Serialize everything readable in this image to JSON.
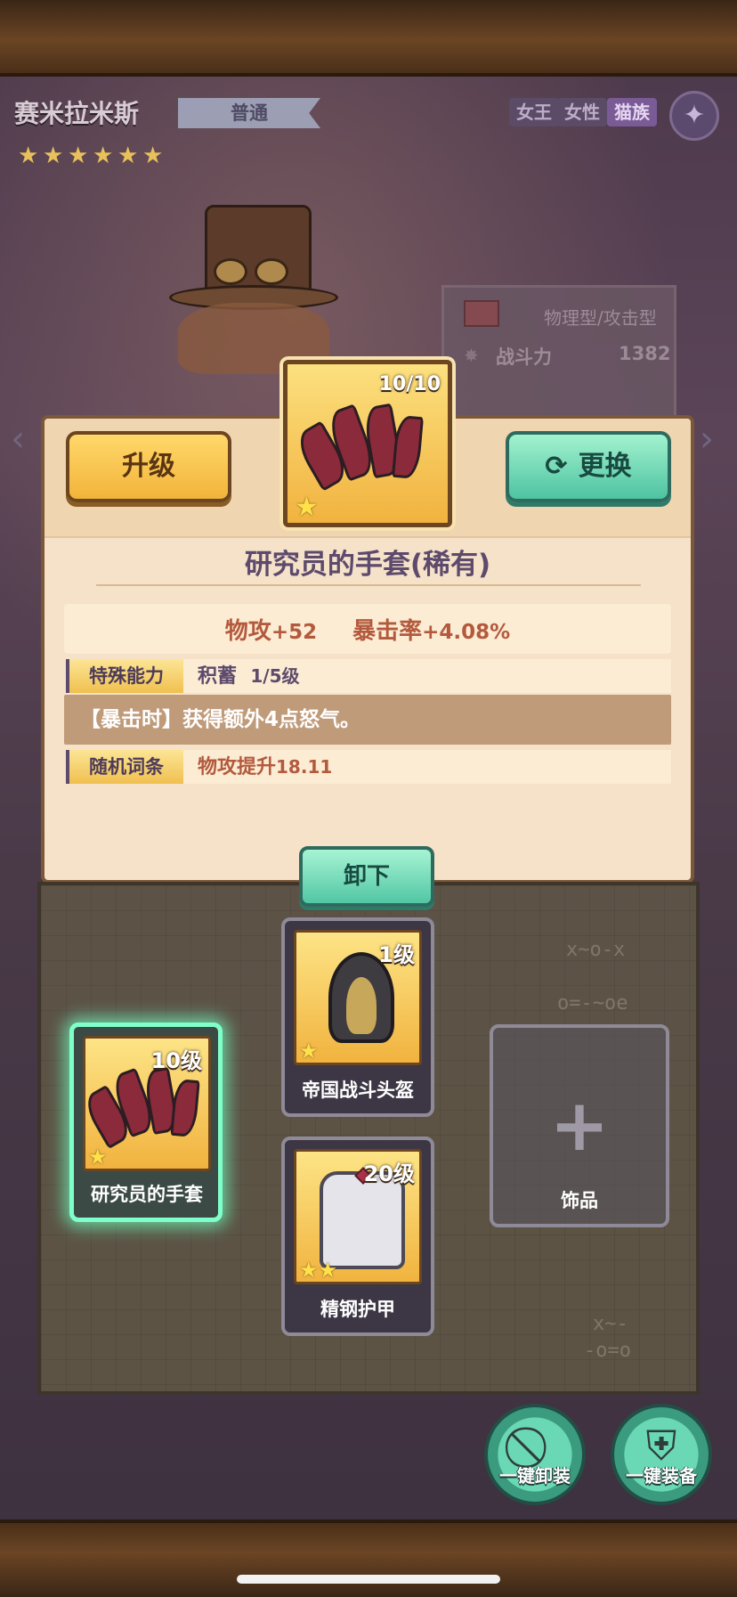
{
  "hero": {
    "name": "赛米拉米斯",
    "rarity": "普通",
    "stars": 6,
    "traits": [
      "女王",
      "女性",
      "猫族"
    ],
    "type": "物理型/攻击型",
    "power_label": "战斗力",
    "power_value": "1382"
  },
  "detail": {
    "upgrade_label": "升级",
    "replace_label": "更换",
    "equip_level": "10/10",
    "item_name": "研究员的手套(稀有)",
    "attrs": [
      {
        "name": "物攻",
        "value": "+52"
      },
      {
        "name": "暴击率",
        "value": "+4.08%"
      }
    ],
    "special_tag": "特殊能力",
    "special_name": "积蓄",
    "special_level": "1/5级",
    "special_desc": "【暴击时】获得额外4点怒气。",
    "random_tag": "随机词条",
    "random_text": "物攻提升",
    "random_value": "18.11",
    "unequip_label": "卸下"
  },
  "slots": {
    "gloves": {
      "name": "研究员的手套",
      "level": "10级",
      "stars": 1
    },
    "helmet": {
      "name": "帝国战斗头盔",
      "level": "1级",
      "stars": 1
    },
    "armor": {
      "name": "精钢护甲",
      "level": "20级",
      "stars": 2
    },
    "accessory": {
      "name": "饰品"
    }
  },
  "actions": {
    "unequip_all": "一键卸装",
    "equip_all": "一键装备"
  },
  "colors": {
    "panel_bg": "#f5e2c8",
    "gold_button": "#f2b43a",
    "teal_button": "#4ec3a1",
    "selected_glow": "#7fffc9"
  }
}
